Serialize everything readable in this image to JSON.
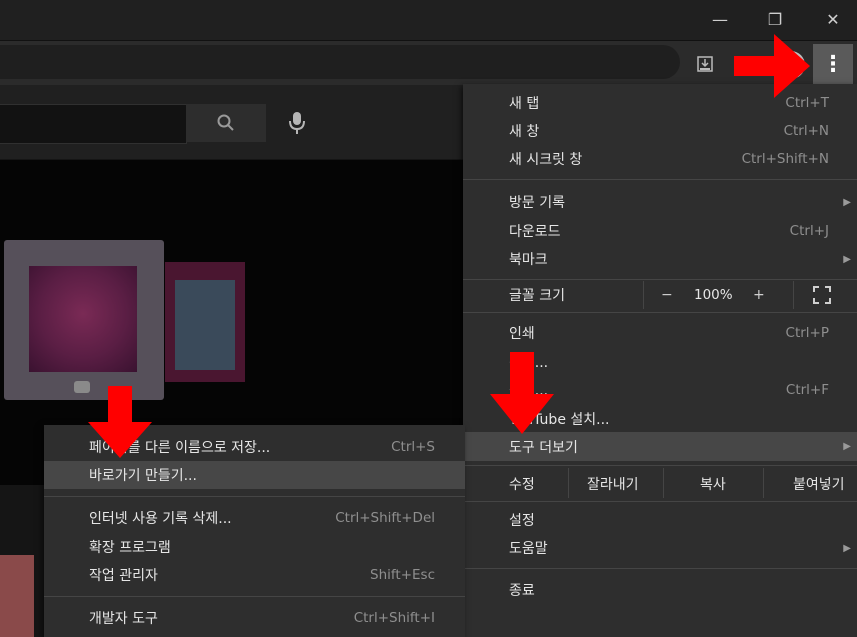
{
  "window": {
    "controls": {
      "minimize": "—",
      "restore": "❐",
      "close": "✕"
    }
  },
  "toolbar": {
    "menu_icon": "⋮",
    "install_icon": "install-icon",
    "avatar_icon": "avatar"
  },
  "youtube": {
    "search_icon": "search-icon",
    "mic_icon": "mic-icon"
  },
  "menu": {
    "new_tab": {
      "label": "새 탭",
      "shortcut": "Ctrl+T"
    },
    "new_window": {
      "label": "새 창",
      "shortcut": "Ctrl+N"
    },
    "new_incognito": {
      "label": "새 시크릿 창",
      "shortcut": "Ctrl+Shift+N"
    },
    "history": {
      "label": "방문 기록"
    },
    "downloads": {
      "label": "다운로드",
      "shortcut": "Ctrl+J"
    },
    "bookmarks": {
      "label": "북마크"
    },
    "zoom": {
      "label": "글꼴 크기",
      "minus": "−",
      "value": "100%",
      "plus": "+"
    },
    "print": {
      "label": "인쇄",
      "shortcut": "Ctrl+P"
    },
    "cast": {
      "label": "전송..."
    },
    "find": {
      "label": "찾기...",
      "shortcut": "Ctrl+F"
    },
    "install": {
      "label": "YouTube 설치..."
    },
    "more_tools": {
      "label": "도구 더보기"
    },
    "edit": {
      "label": "수정",
      "cut": "잘라내기",
      "copy": "복사",
      "paste": "붙여넣기"
    },
    "settings": {
      "label": "설정"
    },
    "help": {
      "label": "도움말"
    },
    "exit": {
      "label": "종료"
    }
  },
  "submenu": {
    "save_page": {
      "label": "페이지를 다른 이름으로 저장...",
      "shortcut": "Ctrl+S"
    },
    "create_shortcut": {
      "label": "바로가기 만들기..."
    },
    "clear_data": {
      "label": "인터넷 사용 기록 삭제...",
      "shortcut": "Ctrl+Shift+Del"
    },
    "extensions": {
      "label": "확장 프로그램"
    },
    "task_manager": {
      "label": "작업 관리자",
      "shortcut": "Shift+Esc"
    },
    "dev_tools": {
      "label": "개발자 도구",
      "shortcut": "Ctrl+Shift+I"
    }
  },
  "colors": {
    "menu_bg": "#2e2e2e",
    "highlight": "#474747",
    "annotation_arrow": "#ff0000"
  }
}
